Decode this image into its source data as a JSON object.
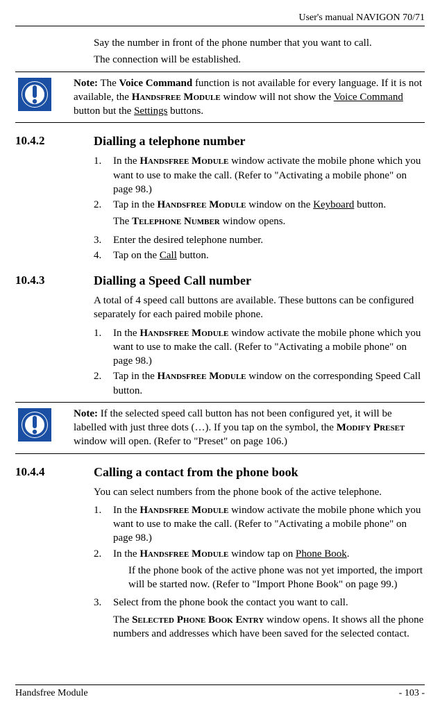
{
  "header": {
    "title": "User's manual NAVIGON 70/71"
  },
  "intro": {
    "line1": "Say the number in front of the phone number that you want to call.",
    "line2": "The connection will be established."
  },
  "note1": {
    "label": "Note:",
    "t1": " The ",
    "vc": "Voice Command",
    "t2": " function is not available for every language. If it is not available, the ",
    "hm": "Handsfree Module",
    "t3": " window will not show the ",
    "u1": "Voice Command",
    "t4": " button but the ",
    "u2": "Settings",
    "t5": " buttons."
  },
  "s1042": {
    "num": "10.4.2",
    "title": "Dialling a telephone number",
    "i1a": "In the ",
    "i1hm": "Handsfree Module",
    "i1b": " window activate the mobile phone which you want to use to make the call. (Refer to \"Activating a mobile phone\" on page 98.)",
    "i2a": "Tap in the ",
    "i2hm": "Handsfree Module",
    "i2b": " window on the ",
    "i2k": "Keyboard",
    "i2c": " button.",
    "i2d": "The ",
    "i2tn": "Telephone Number",
    "i2e": " window opens.",
    "i3": "Enter the desired telephone number.",
    "i4a": "Tap on the ",
    "i4call": "Call",
    "i4b": " button."
  },
  "s1043": {
    "num": "10.4.3",
    "title": "Dialling a Speed Call number",
    "intro": "A total of 4 speed call buttons are available. These buttons can be configured separately for each paired mobile phone.",
    "i1a": "In the ",
    "i1hm": "Handsfree Module",
    "i1b": " window activate the mobile phone which you want to use to make the call. (Refer to \"Activating a mobile phone\" on page 98.)",
    "i2a": "Tap in the ",
    "i2hm": "Handsfree Module",
    "i2b": " window on the corresponding Speed Call button."
  },
  "note2": {
    "label": "Note:",
    "t1": " If the selected speed call button has not been configured yet, it will be labelled with just three dots (…). If you tap on the symbol, the ",
    "mp": "Modify Preset",
    "t2": " window will open. (Refer to \"Preset\" on page 106.)"
  },
  "s1044": {
    "num": "10.4.4",
    "title": "Calling a contact from the phone book",
    "intro": "You can select numbers from the phone book of the active telephone.",
    "i1a": "In the ",
    "i1hm": "Handsfree Module",
    "i1b": " window activate the mobile phone which you want to use to make the call. (Refer to \"Activating a mobile phone\" on page 98.)",
    "i2a": "In the ",
    "i2hm": "Handsfree Module",
    "i2b": " window tap on ",
    "i2pb": "Phone Book",
    "i2c": ".",
    "i2sub": "If the phone book of the active phone was not yet imported, the import will be started now. (Refer to \"Import Phone Book\" on page 99.)",
    "i3a": "Select from the phone book the contact you want to call.",
    "i3b": "The ",
    "i3se": "Selected Phone Book Entry",
    "i3c": " window opens. It shows all the phone numbers and addresses which have been saved for the selected contact."
  },
  "footer": {
    "left": "Handsfree Module",
    "right": "- 103 -"
  }
}
